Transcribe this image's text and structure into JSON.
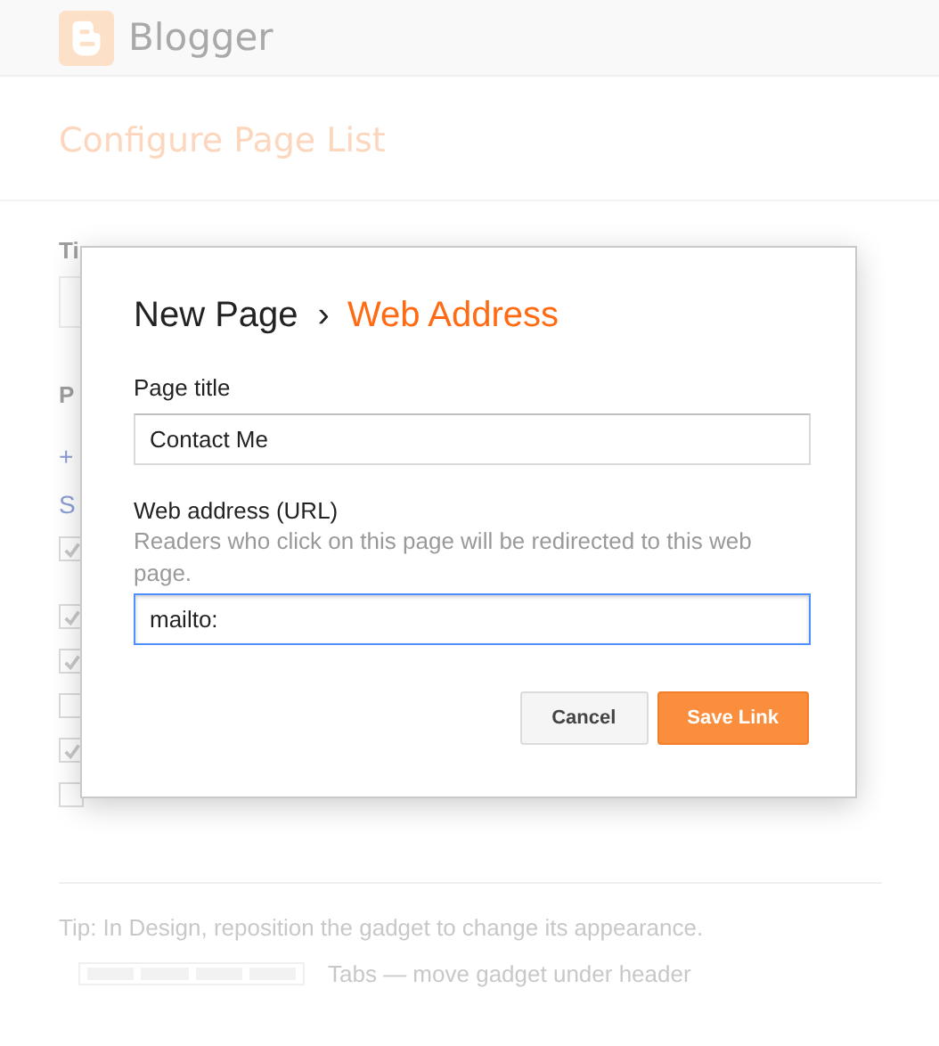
{
  "header": {
    "logo_text": "Blogger"
  },
  "page_title": "Configure Page List",
  "background": {
    "labels": [
      {
        "text": "Ti",
        "kind": "label"
      },
      {
        "text": "P",
        "kind": "label"
      },
      {
        "text": "+",
        "kind": "link"
      },
      {
        "text": "S",
        "kind": "link"
      }
    ],
    "checkboxes": [
      {
        "checked": true
      },
      {
        "checked": true
      },
      {
        "checked": true
      },
      {
        "checked": false
      },
      {
        "checked": true
      },
      {
        "checked": false
      }
    ]
  },
  "dialog": {
    "breadcrumb": {
      "parent": "New Page",
      "separator": "›",
      "current": "Web Address"
    },
    "fields": [
      {
        "label": "Page title",
        "value": "Contact Me",
        "focused": false
      },
      {
        "label": "Web address (URL)",
        "help": "Readers who click on this page will be redirected to this web page.",
        "value": "mailto:",
        "focused": true
      }
    ],
    "buttons": [
      {
        "label": "Cancel",
        "kind": "secondary"
      },
      {
        "label": "Save Link",
        "kind": "primary"
      }
    ]
  },
  "tip": "Tip: In Design, reposition the gadget to change its appearance.",
  "layouts": [
    {
      "label": "Tabs — move gadget under header"
    }
  ]
}
